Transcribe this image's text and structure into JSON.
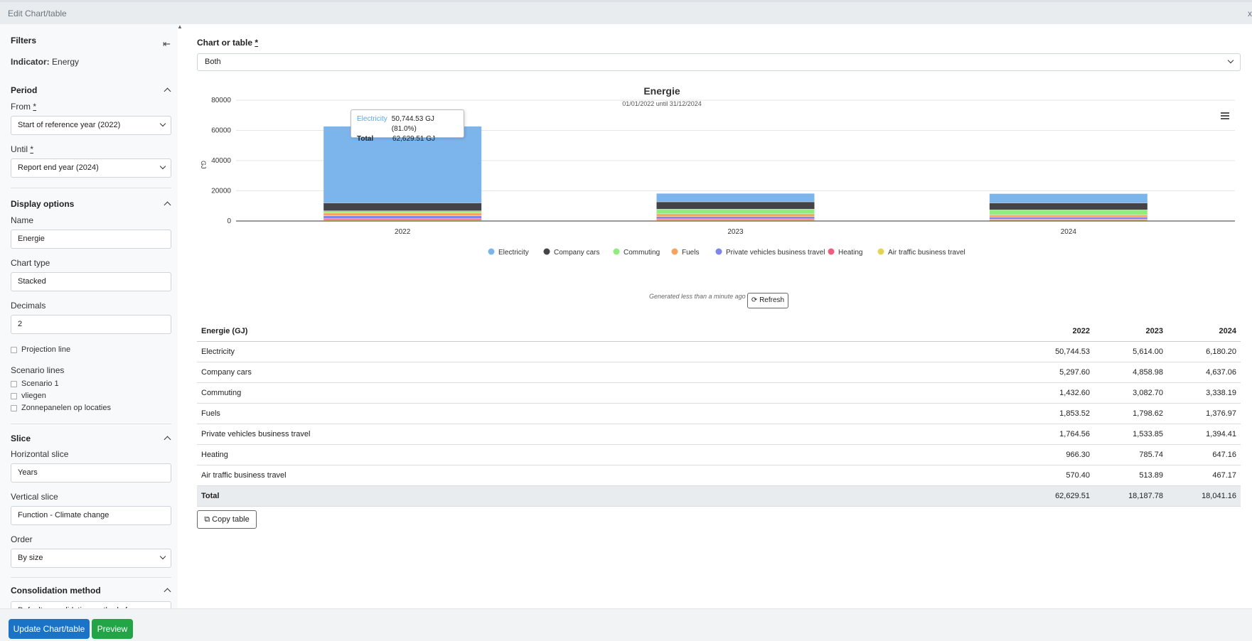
{
  "window": {
    "title": "Edit Chart/table",
    "close_glyph": "x"
  },
  "sidebar": {
    "title": "Filters",
    "indicator_label": "Indicator:",
    "indicator_value": "Energy",
    "period": {
      "heading": "Period",
      "from_label": "From",
      "from_value": "Start of reference year (2022)",
      "until_label": "Until",
      "until_value": "Report end year (2024)",
      "required_mark": "*"
    },
    "display": {
      "heading": "Display options",
      "name_label": "Name",
      "name_value": "Energie",
      "chart_type_label": "Chart type",
      "chart_type_value": "Stacked",
      "decimals_label": "Decimals",
      "decimals_value": "2",
      "projection_label": "Projection line",
      "scenario_lines_label": "Scenario lines",
      "scenarios": [
        "Scenario 1",
        "vliegen",
        "Zonnepanelen op locaties"
      ]
    },
    "slice": {
      "heading": "Slice",
      "horizontal_label": "Horizontal slice",
      "horizontal_value": "Years",
      "vertical_label": "Vertical slice",
      "vertical_value": "Function - Climate change",
      "order_label": "Order",
      "order_value": "By size"
    },
    "consolidation": {
      "heading": "Consolidation method",
      "value": "Default consolidation method of"
    }
  },
  "footer": {
    "update_label": "Update Chart/table",
    "preview_label": "Preview"
  },
  "main": {
    "chart_or_table_label": "Chart or table",
    "required_mark": "*",
    "chart_or_table_value": "Both",
    "generated_text": "Generated less than a minute ago",
    "refresh_label": "Refresh",
    "copy_label": "Copy table"
  },
  "tooltip": {
    "series": "Electricity",
    "series_value": "50,744.53 GJ (81.0%)",
    "total_label": "Total",
    "total_value": "62,629.51 GJ"
  },
  "chart_data": {
    "type": "bar",
    "stacked": true,
    "title": "Energie",
    "subtitle": "01/01/2022 until 31/12/2024",
    "ylabel": "GJ",
    "xlabel": "",
    "ylim": [
      0,
      80000
    ],
    "yticks": [
      0,
      20000,
      40000,
      60000,
      80000
    ],
    "grid": true,
    "legend": "bottom",
    "categories": [
      "2022",
      "2023",
      "2024"
    ],
    "series": [
      {
        "name": "Electricity",
        "color": "#7cb5ec",
        "values": [
          50744.53,
          5614.0,
          6180.2
        ]
      },
      {
        "name": "Company cars",
        "color": "#434348",
        "values": [
          5297.6,
          4858.98,
          4637.06
        ]
      },
      {
        "name": "Commuting",
        "color": "#90ed7d",
        "values": [
          1432.6,
          3082.7,
          3338.19
        ]
      },
      {
        "name": "Fuels",
        "color": "#f7a35c",
        "values": [
          1853.52,
          1798.62,
          1376.97
        ]
      },
      {
        "name": "Private vehicles business travel",
        "color": "#8085e9",
        "values": [
          1764.56,
          1533.85,
          1394.41
        ]
      },
      {
        "name": "Heating",
        "color": "#f15c80",
        "values": [
          966.3,
          785.74,
          647.16
        ]
      },
      {
        "name": "Air traffic business travel",
        "color": "#e4d354",
        "values": [
          570.4,
          513.89,
          467.17
        ]
      }
    ]
  },
  "table": {
    "header": "Energie (GJ)",
    "columns": [
      "2022",
      "2023",
      "2024"
    ],
    "rows": [
      {
        "label": "Electricity",
        "values": [
          "50,744.53",
          "5,614.00",
          "6,180.20"
        ]
      },
      {
        "label": "Company cars",
        "values": [
          "5,297.60",
          "4,858.98",
          "4,637.06"
        ]
      },
      {
        "label": "Commuting",
        "values": [
          "1,432.60",
          "3,082.70",
          "3,338.19"
        ]
      },
      {
        "label": "Fuels",
        "values": [
          "1,853.52",
          "1,798.62",
          "1,376.97"
        ]
      },
      {
        "label": "Private vehicles business travel",
        "values": [
          "1,764.56",
          "1,533.85",
          "1,394.41"
        ]
      },
      {
        "label": "Heating",
        "values": [
          "966.30",
          "785.74",
          "647.16"
        ]
      },
      {
        "label": "Air traffic business travel",
        "values": [
          "570.40",
          "513.89",
          "467.17"
        ]
      }
    ],
    "total": {
      "label": "Total",
      "values": [
        "62,629.51",
        "18,187.78",
        "18,041.16"
      ]
    }
  }
}
